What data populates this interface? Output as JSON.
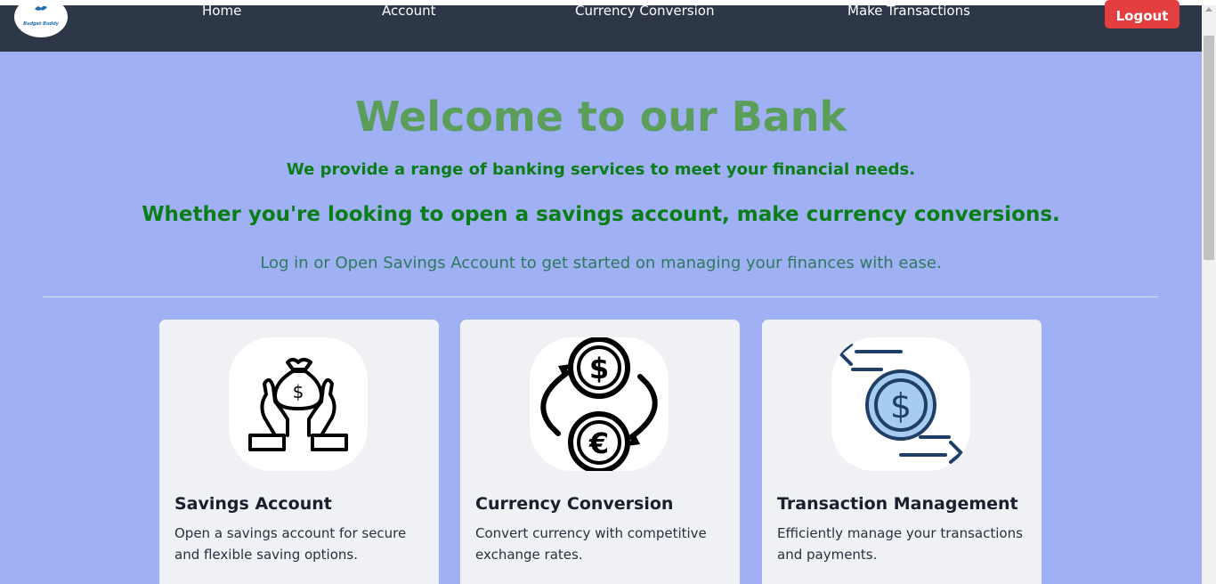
{
  "nav": {
    "logo_text": "Budget Buddy",
    "links": [
      "Home",
      "Account",
      "Currency Conversion",
      "Make Transactions"
    ],
    "logout_label": "Logout"
  },
  "hero": {
    "title": "Welcome to our Bank",
    "subtitle": "We provide a range of banking services to meet your financial needs.",
    "tagline": "Whether you're looking to open a savings account, make currency conversions.",
    "cta_text": "Log in or Open Savings Account to get started on managing your finances with ease."
  },
  "cards": [
    {
      "icon": "money-bag-hands-icon",
      "title": "Savings Account",
      "description": "Open a savings account for secure and flexible saving options."
    },
    {
      "icon": "currency-exchange-icon",
      "title": "Currency Conversion",
      "description": "Convert currency with competitive exchange rates."
    },
    {
      "icon": "dollar-transfer-icon",
      "title": "Transaction Management",
      "description": "Efficiently manage your transactions and payments."
    }
  ],
  "colors": {
    "background": "#a0b0f4",
    "navbar": "#2d3748",
    "logout": "#e53e3e",
    "title": "#5a9e5a",
    "subtitle": "#0a7e16",
    "card": "#f0f1f5"
  }
}
